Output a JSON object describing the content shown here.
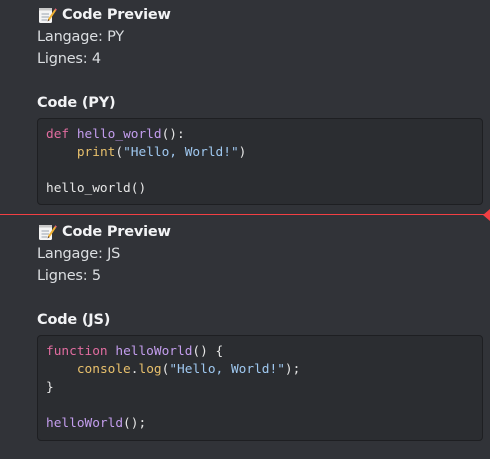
{
  "messages": [
    {
      "header": {
        "emoji": "memo-icon",
        "title": "Code Preview"
      },
      "language_line": "Langage: PY",
      "lines_line": "Lignes: 4",
      "code_title": "Code (PY)",
      "code": {
        "line1": {
          "kw": "def",
          "fn": "hello_world",
          "rest": "():"
        },
        "line2": {
          "indent": "    ",
          "fn": "print",
          "open": "(",
          "str": "\"Hello, World!\"",
          "close": ")"
        },
        "line3": "",
        "line4": {
          "fn": "hello_world",
          "rest": "()"
        }
      }
    },
    {
      "header": {
        "emoji": "memo-icon",
        "title": "Code Preview"
      },
      "language_line": "Langage: JS",
      "lines_line": "Lignes: 5",
      "code_title": "Code (JS)",
      "code": {
        "line1": {
          "kw": "function",
          "fn": "helloWorld",
          "rest": "() {"
        },
        "line2": {
          "indent": "    ",
          "obj": "console",
          "dot": ".",
          "fn": "log",
          "open": "(",
          "str": "\"Hello, World!\"",
          "close": ");"
        },
        "line3": "}",
        "line4": "",
        "line5": {
          "fn": "helloWorld",
          "rest": "();"
        }
      }
    }
  ],
  "colors": {
    "background": "#313338",
    "code_background": "#2b2d31",
    "new_divider": "#f23f43",
    "keyword": "#e06c9f",
    "function": "#c39ded",
    "string": "#9fc8f0",
    "builtin": "#e8c06c"
  }
}
